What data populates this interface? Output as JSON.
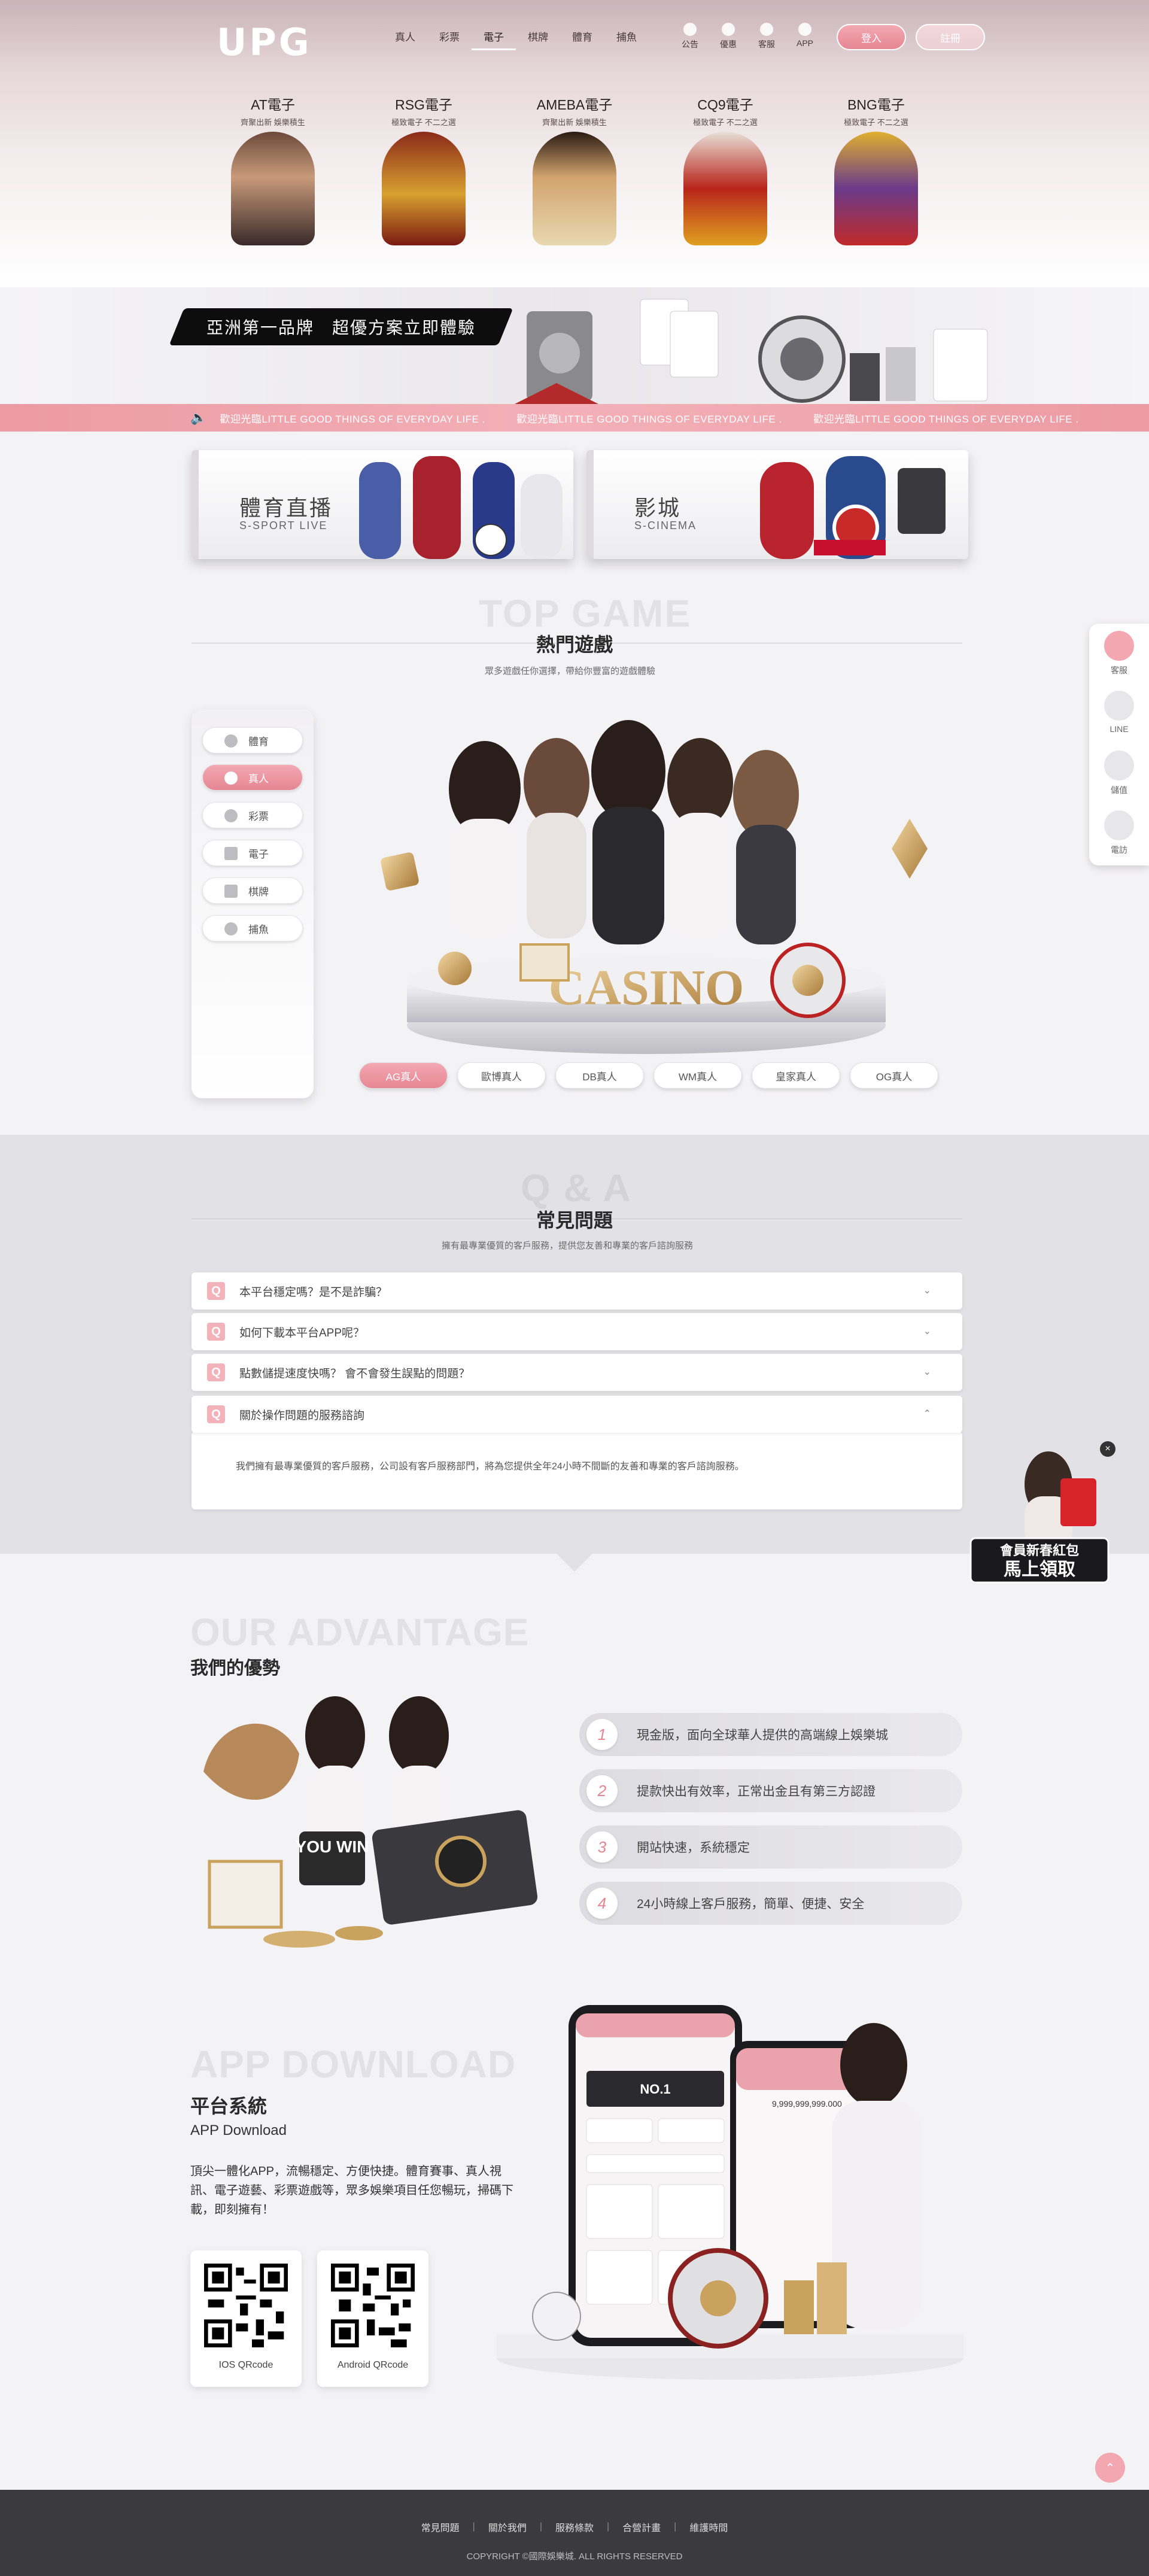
{
  "header": {
    "logo": "UPG",
    "nav": [
      {
        "label": "真人",
        "active": false
      },
      {
        "label": "彩票",
        "active": false
      },
      {
        "label": "電子",
        "active": true
      },
      {
        "label": "棋牌",
        "active": false
      },
      {
        "label": "體育",
        "active": false
      },
      {
        "label": "捕魚",
        "active": false
      }
    ],
    "utilities": [
      {
        "label": "公告",
        "icon": "bell-icon"
      },
      {
        "label": "優惠",
        "icon": "gift-icon"
      },
      {
        "label": "客服",
        "icon": "support-icon"
      },
      {
        "label": "APP",
        "icon": "phone-icon"
      }
    ],
    "login_label": "登入",
    "register_label": "註冊"
  },
  "providers": [
    {
      "name": "AT電子",
      "desc": "齊聚出新 娛樂積生"
    },
    {
      "name": "RSG電子",
      "desc": "極致電子 不二之選"
    },
    {
      "name": "AMEBA電子",
      "desc": "齊聚出新 娛樂積生"
    },
    {
      "name": "CQ9電子",
      "desc": "極致電子 不二之選"
    },
    {
      "name": "BNG電子",
      "desc": "極致電子 不二之選"
    }
  ],
  "banner": {
    "slogan": "亞洲第一品牌　超優方案立即體驗"
  },
  "marquee": {
    "text": "歡迎光臨LITTLE GOOD THINGS OF EVERYDAY LIFE .　　　歡迎光臨LITTLE GOOD THINGS OF EVERYDAY LIFE .　　　歡迎光臨LITTLE GOOD THINGS OF EVERYDAY LIFE ."
  },
  "promos": [
    {
      "title": "體育直播",
      "sub": "S-SPORT LIVE"
    },
    {
      "title": "影城",
      "sub": "S-CINEMA"
    }
  ],
  "top_game": {
    "bg_title": "TOP GAME",
    "title": "熱門遊戲",
    "subtitle": "眾多遊戲任你選擇，帶給你豐富的遊戲體驗",
    "categories": [
      {
        "label": "體育",
        "active": false
      },
      {
        "label": "真人",
        "active": true
      },
      {
        "label": "彩票",
        "active": false
      },
      {
        "label": "電子",
        "active": false
      },
      {
        "label": "棋牌",
        "active": false
      },
      {
        "label": "捕魚",
        "active": false
      }
    ],
    "sub_tabs": [
      {
        "label": "AG真人",
        "active": true
      },
      {
        "label": "歐博真人",
        "active": false
      },
      {
        "label": "DB真人",
        "active": false
      },
      {
        "label": "WM真人",
        "active": false
      },
      {
        "label": "皇家真人",
        "active": false
      },
      {
        "label": "OG真人",
        "active": false
      }
    ],
    "casino_sign": "CASINO"
  },
  "faq": {
    "bg_title": "Q & A",
    "title": "常見問題",
    "subtitle": "擁有最專業優質的客戶服務，提供您友善和專業的客戶諮詢服務",
    "items": [
      {
        "q": "本平台穩定嗎？是不是詐騙？",
        "open": false
      },
      {
        "q": "如何下載本平台APP呢？",
        "open": false
      },
      {
        "q": "點數儲提速度快嗎？ 會不會發生誤點的問題？",
        "open": false
      },
      {
        "q": "關於操作問題的服務諮詢",
        "open": true
      }
    ],
    "answer": "我們擁有最專業優質的客戶服務，公司設有客戶服務部門，將為您提供全年24小時不間斷的友善和專業的客戶諮詢服務。"
  },
  "side_float": [
    {
      "label": "客服"
    },
    {
      "label": "LINE"
    },
    {
      "label": "儲值"
    },
    {
      "label": "電訪"
    }
  ],
  "hongbao": {
    "line1": "會員新春紅包",
    "line2": "馬上領取",
    "close": "×"
  },
  "advantage": {
    "bg_title": "OUR ADVANTAGE",
    "title": "我們的優勢",
    "items": [
      {
        "num": "1",
        "text": "現金版，面向全球華人提供的高端線上娛樂城"
      },
      {
        "num": "2",
        "text": "提款快出有效率，正常出金且有第三方認證"
      },
      {
        "num": "3",
        "text": "開站快速，系統穩定"
      },
      {
        "num": "4",
        "text": "24小時線上客戶服務，簡單、便捷、安全"
      }
    ],
    "badge": "YOU WIN"
  },
  "app": {
    "bg_title": "APP DOWNLOAD",
    "title": "平台系統",
    "sub": "APP Download",
    "desc": "頂尖一體化APP，流暢穩定、方便快捷。體育賽事、真人視訊、電子遊藝、彩票遊戲等，眾多娛樂項目任您暢玩，掃碼下載，即刻擁有！",
    "qrs": [
      {
        "label": "IOS QRcode"
      },
      {
        "label": "Android QRcode"
      }
    ],
    "phone_banner": "NO.1",
    "phone_balance": "9,999,999,999.000"
  },
  "footer": {
    "links": [
      "常見問題",
      "關於我們",
      "服務條款",
      "合營計畫",
      "維護時間"
    ],
    "copyright": "COPYRIGHT ©國際娛樂城. ALL RIGHTS RESERVED"
  }
}
